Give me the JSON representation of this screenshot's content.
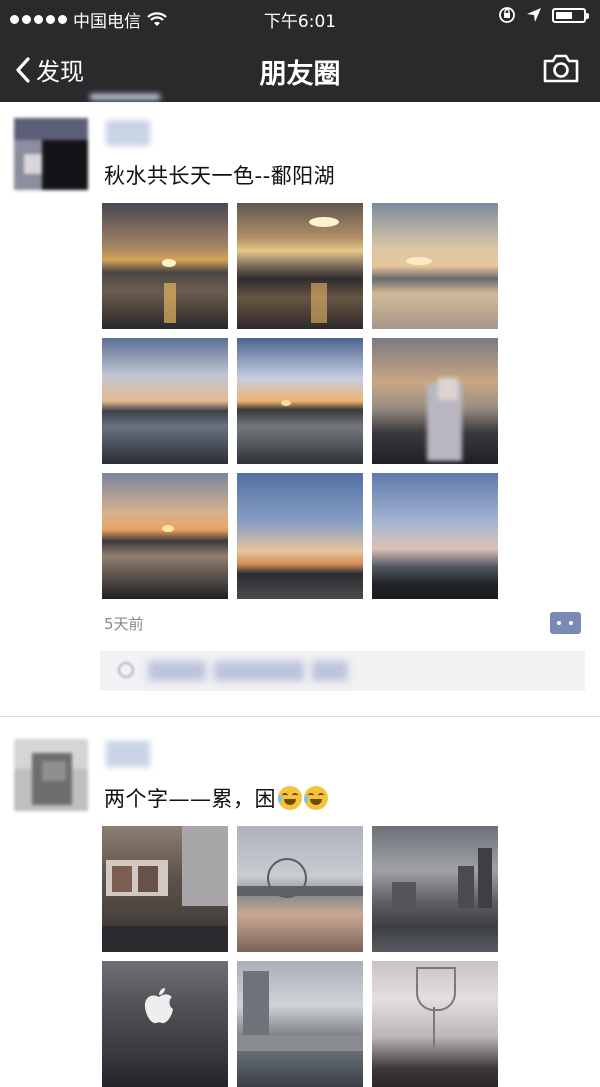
{
  "status_bar": {
    "carrier": "中国电信",
    "time": "下午6:01",
    "battery_level": 0.6
  },
  "nav": {
    "back_label": "发现",
    "title": "朋友圈",
    "camera_icon": "camera-icon"
  },
  "posts": [
    {
      "text": "秋水共长天一色--鄱阳湖",
      "time": "5天前",
      "photo_count": 9
    },
    {
      "text": "两个字——累，困",
      "emoji": [
        "crying-laughing-emoji",
        "crying-laughing-emoji"
      ],
      "photo_count": 6
    }
  ],
  "colors": {
    "bar": "#2a2a2c",
    "name_link": "#576b95",
    "likes_bg": "#f2f2f4"
  }
}
